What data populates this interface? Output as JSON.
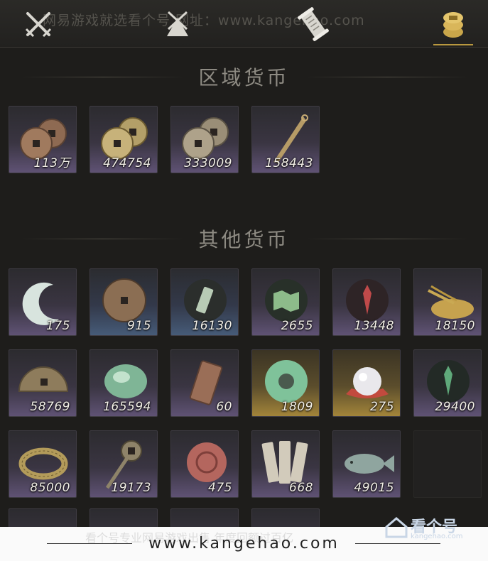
{
  "header": {
    "watermark": "网易游戏就选看个号  网址：www.kangehao.com",
    "tabs": [
      {
        "icon": "crossed-swords-icon"
      },
      {
        "icon": "merchant-cart-icon"
      },
      {
        "icon": "scroll-icon"
      },
      {
        "icon": "currency-stack-icon",
        "active": true
      }
    ]
  },
  "sections": [
    {
      "title": "区域货币",
      "items": [
        {
          "icon": "copper-coins-icon",
          "qty": "113万",
          "rarity": "purple"
        },
        {
          "icon": "gold-coins-icon",
          "qty": "474754",
          "rarity": "purple"
        },
        {
          "icon": "silver-coins-icon",
          "qty": "333009",
          "rarity": "purple"
        },
        {
          "icon": "dagger-token-icon",
          "qty": "158443",
          "rarity": "purple"
        }
      ]
    },
    {
      "title": "其他货币",
      "items": [
        {
          "icon": "jade-crescent-icon",
          "qty": "175",
          "rarity": "purple"
        },
        {
          "icon": "bronze-medallion-icon",
          "qty": "915",
          "rarity": "blue"
        },
        {
          "icon": "jade-tag-icon",
          "qty": "16130",
          "rarity": "blue"
        },
        {
          "icon": "jade-map-icon",
          "qty": "2655",
          "rarity": "purple"
        },
        {
          "icon": "red-sigil-icon",
          "qty": "13448",
          "rarity": "purple"
        },
        {
          "icon": "grain-pile-icon",
          "qty": "18150",
          "rarity": "purple"
        },
        {
          "icon": "half-coin-icon",
          "qty": "58769",
          "rarity": "purple"
        },
        {
          "icon": "jade-stone-icon",
          "qty": "165594",
          "rarity": "purple"
        },
        {
          "icon": "bronze-plaque-icon",
          "qty": "60",
          "rarity": "purple"
        },
        {
          "icon": "jade-ring-icon",
          "qty": "1809",
          "rarity": "gold"
        },
        {
          "icon": "pearl-icon",
          "qty": "275",
          "rarity": "gold"
        },
        {
          "icon": "green-sigil-icon",
          "qty": "29400",
          "rarity": "purple"
        },
        {
          "icon": "coin-string-icon",
          "qty": "85000",
          "rarity": "purple"
        },
        {
          "icon": "coin-sword-icon",
          "qty": "19173",
          "rarity": "purple"
        },
        {
          "icon": "clay-seal-icon",
          "qty": "475",
          "rarity": "purple"
        },
        {
          "icon": "bamboo-slips-icon",
          "qty": "668",
          "rarity": "purple"
        },
        {
          "icon": "jade-fish-icon",
          "qty": "49015",
          "rarity": "purple"
        },
        {
          "icon": "empty-slot",
          "qty": "",
          "rarity": "empty"
        }
      ]
    }
  ],
  "footer": {
    "url": "www.kangehao.com",
    "faint_text": "看个号专业网易游戏出售  年度回额过百亿",
    "brand_name": "看个号",
    "brand_url": "kangehao.com"
  },
  "colors": {
    "background": "#1e1d1b",
    "rarity_purple": "#5f5274",
    "rarity_blue": "#465b78",
    "rarity_gold": "#a3853a",
    "active_tab": "#b9983f"
  }
}
